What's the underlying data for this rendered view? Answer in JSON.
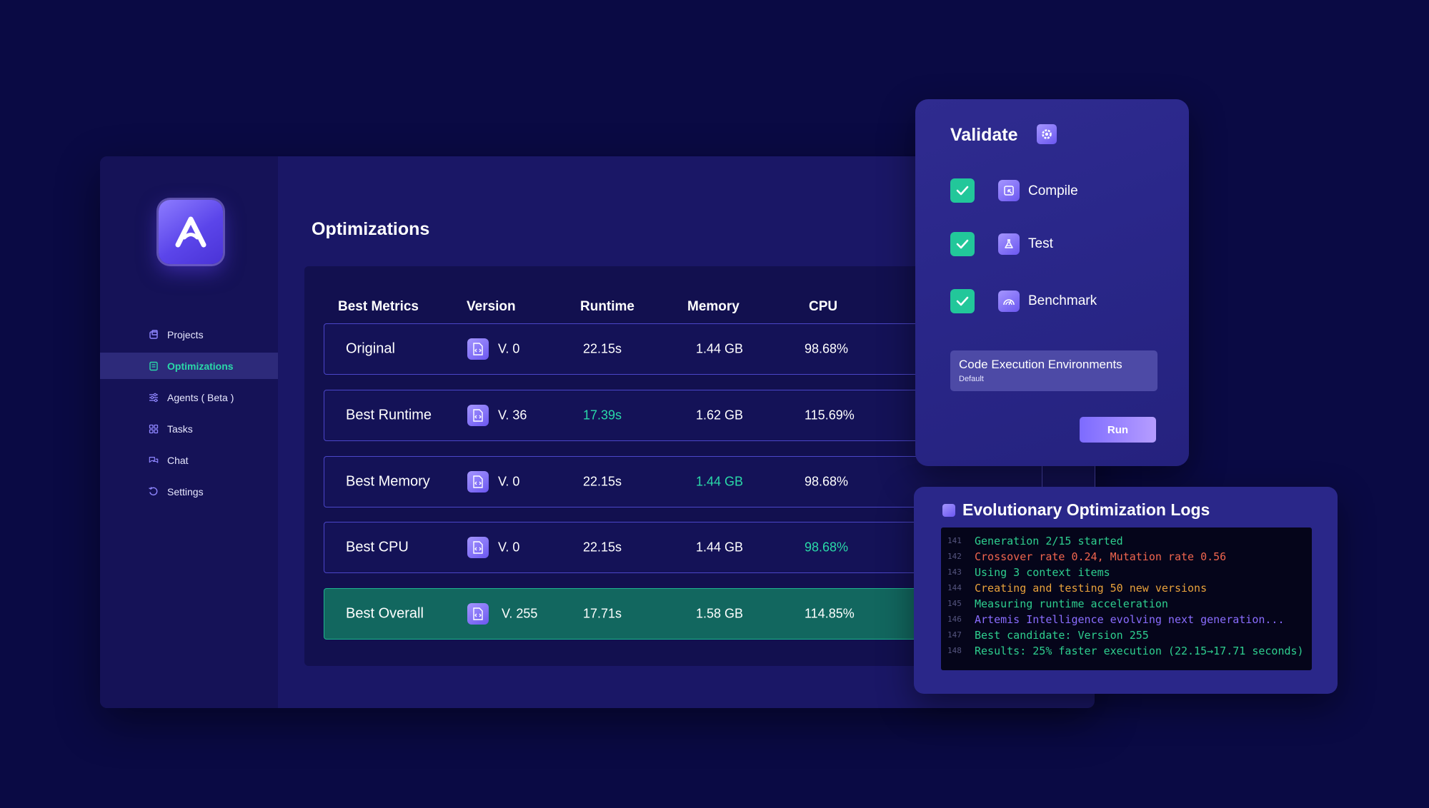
{
  "sidebar": {
    "items": [
      {
        "label": "Projects",
        "icon": "projects-icon",
        "active": false
      },
      {
        "label": "Optimizations",
        "icon": "optimizations-icon",
        "active": true
      },
      {
        "label": "Agents ( Beta )",
        "icon": "agents-icon",
        "active": false
      },
      {
        "label": "Tasks",
        "icon": "tasks-icon",
        "active": false
      },
      {
        "label": "Chat",
        "icon": "chat-icon",
        "active": false
      },
      {
        "label": "Settings",
        "icon": "settings-icon",
        "active": false
      }
    ]
  },
  "main": {
    "title": "Optimizations",
    "table": {
      "headers": [
        "Best Metrics",
        "Version",
        "Runtime",
        "Memory",
        "CPU"
      ],
      "rows": [
        {
          "name": "Original",
          "version": "V. 0",
          "runtime": "22.15s",
          "memory": "1.44 GB",
          "cpu": "98.68%"
        },
        {
          "name": "Best Runtime",
          "version": "V. 36",
          "runtime": "17.39s",
          "memory": "1.62 GB",
          "cpu": "115.69%"
        },
        {
          "name": "Best Memory",
          "version": "V. 0",
          "runtime": "22.15s",
          "memory": "1.44 GB",
          "cpu": "98.68%"
        },
        {
          "name": "Best CPU",
          "version": "V. 0",
          "runtime": "22.15s",
          "memory": "1.44 GB",
          "cpu": "98.68%"
        },
        {
          "name": "Best Overall",
          "version": "V. 255",
          "runtime": "17.71s",
          "memory": "1.58 GB",
          "cpu": "114.85%"
        }
      ]
    }
  },
  "validate": {
    "title": "Validate",
    "steps": [
      {
        "label": "Compile",
        "icon": "compile-icon",
        "checked": true
      },
      {
        "label": "Test",
        "icon": "flask-icon",
        "checked": true
      },
      {
        "label": "Benchmark",
        "icon": "gauge-icon",
        "checked": true
      }
    ],
    "env": {
      "title": "Code Execution Environments",
      "value": "Default"
    },
    "run_label": "Run"
  },
  "logs": {
    "title": "Evolutionary Optimization Logs",
    "lines": [
      {
        "num": "141",
        "text": "Generation 2/15 started",
        "color": "#2ecf8f"
      },
      {
        "num": "142",
        "text": "Crossover rate 0.24, Mutation rate 0.56",
        "color": "#f0654e"
      },
      {
        "num": "143",
        "text": "Using 3 context items",
        "color": "#2ecf8f"
      },
      {
        "num": "144",
        "text": "Creating and testing 50 new versions",
        "color": "#e9a23b"
      },
      {
        "num": "145",
        "text": "Measuring runtime acceleration",
        "color": "#2ecf8f"
      },
      {
        "num": "146",
        "text": "Artemis Intelligence evolving next generation...",
        "color": "#8a6dff"
      },
      {
        "num": "147",
        "text": "Best candidate: Version 255",
        "color": "#2ecf8f"
      },
      {
        "num": "148",
        "text": "Results: 25% faster execution (22.15→17.71 seconds)",
        "color": "#2ecf8f"
      }
    ]
  },
  "colors": {
    "background": "#0a0a44",
    "accent": "#2ad9a8",
    "best_row": "#12675f",
    "check": "#22c79a"
  }
}
